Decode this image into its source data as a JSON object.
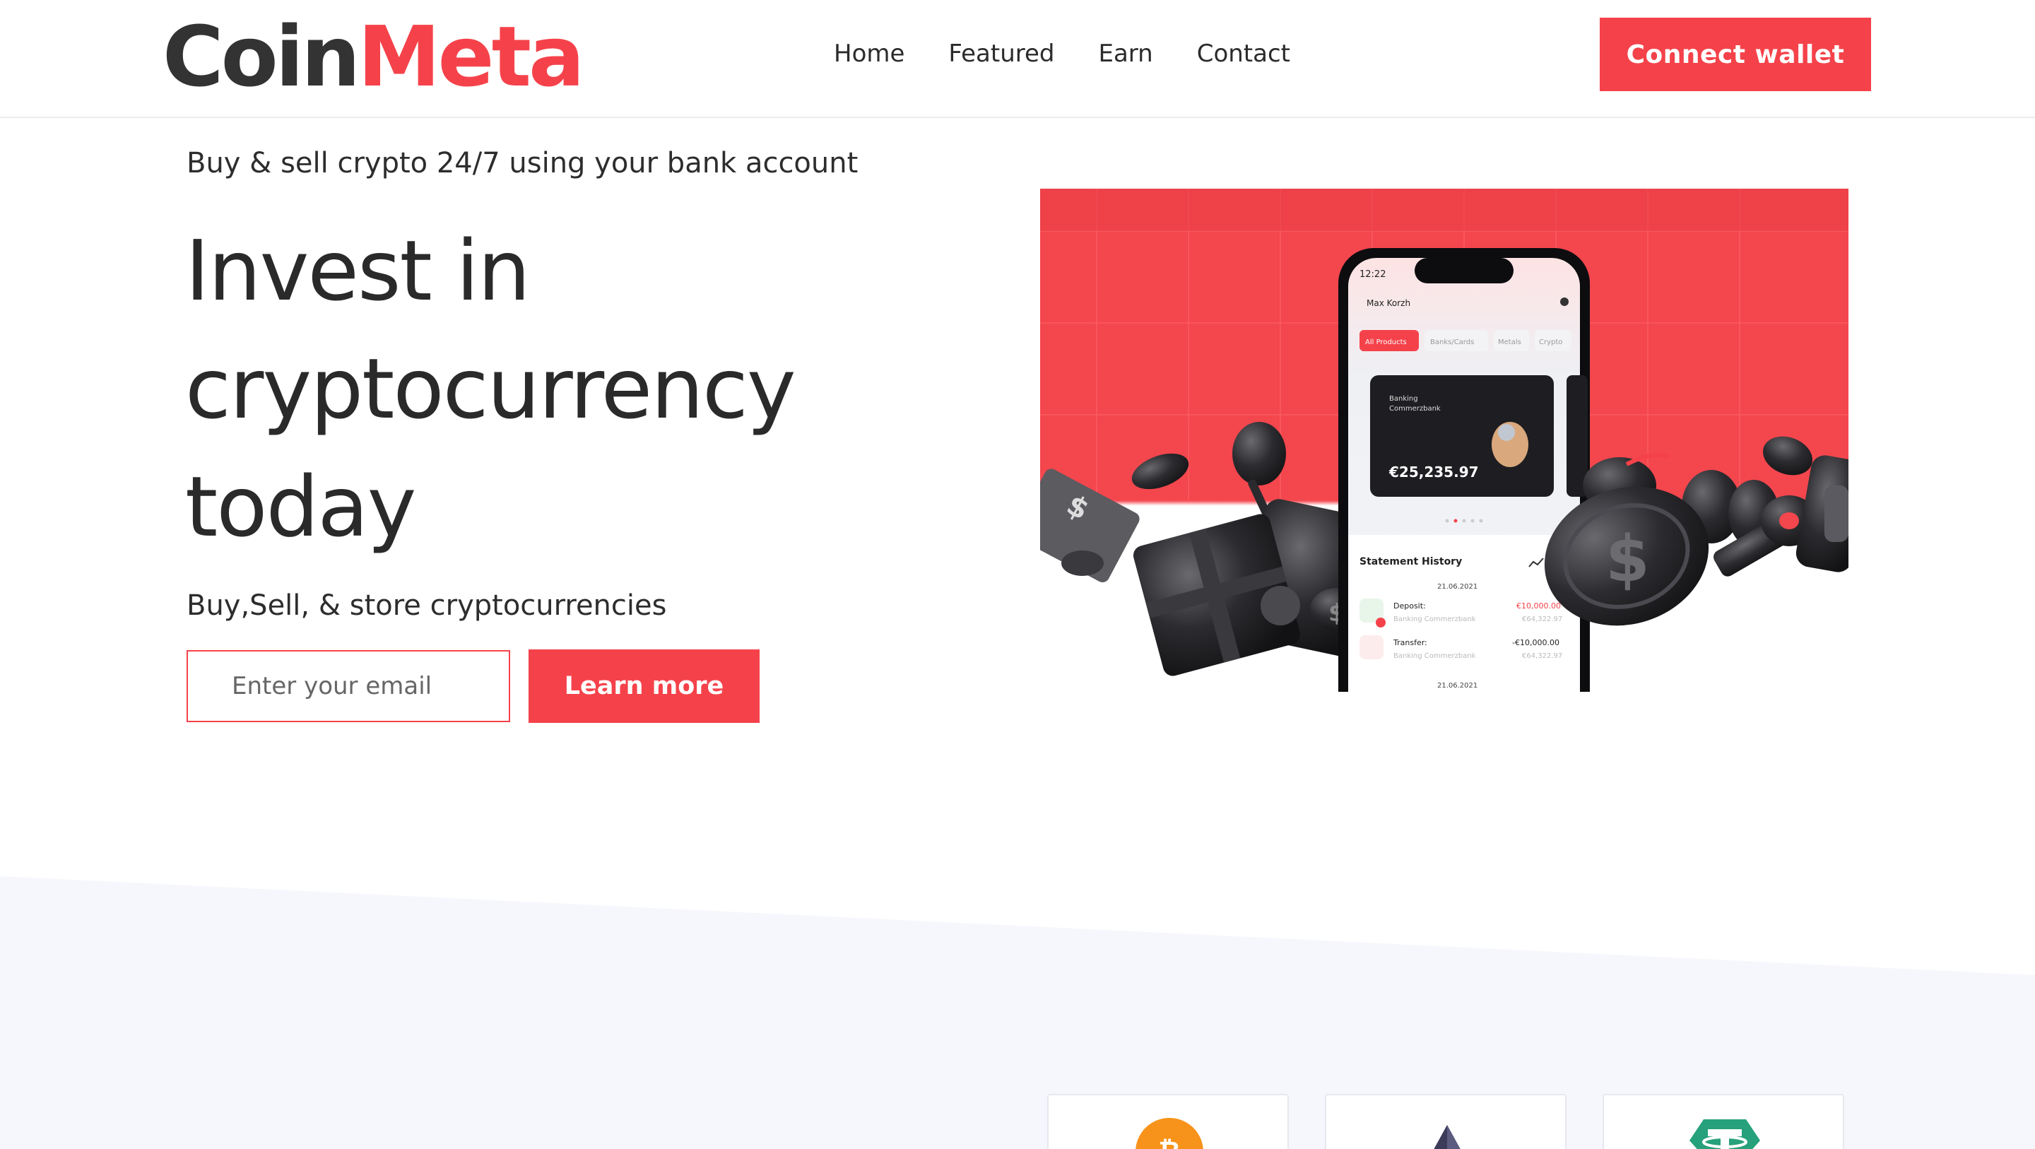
{
  "brand": {
    "name_part1": "Coin",
    "name_part2": "Meta",
    "dark_color": "#333333",
    "accent_color": "#f5424a"
  },
  "nav": {
    "items": [
      {
        "label": "Home"
      },
      {
        "label": "Featured"
      },
      {
        "label": "Earn"
      },
      {
        "label": "Contact"
      }
    ],
    "connect_label": "Connect wallet"
  },
  "hero": {
    "tagline": "Buy & sell crypto 24/7 using your bank account",
    "title_lines": [
      "Invest in",
      "cryptocurrency",
      "today"
    ],
    "subtitle": "Buy,Sell, & store cryptocurrencies",
    "email_placeholder": "Enter your email",
    "cta_label": "Learn more"
  },
  "phone": {
    "time": "12:22",
    "user": "Max Korzh",
    "tabs": [
      "All Products",
      "Banks/Cards",
      "Metals",
      "Crypto"
    ],
    "card_label_1": "Banking",
    "card_label_2": "Commerzbank",
    "card_balance": "€25,235.97",
    "history_title": "Statement History",
    "date_1": "21.06.2021",
    "tx": [
      {
        "label": "Deposit:",
        "sub": "Banking Commerzbank",
        "amount": "€10,000.00",
        "balance": "€64,322.97"
      },
      {
        "label": "Transfer:",
        "sub": "Banking Commerzbank",
        "amount": "-€10,000.00",
        "balance": "€64,322.97"
      }
    ],
    "date_2": "21.06.2021"
  },
  "coins": [
    {
      "icon": "bitcoin-icon",
      "color": "#f7931a"
    },
    {
      "icon": "ethereum-icon",
      "color": "#3c3c5a"
    },
    {
      "icon": "tether-icon",
      "color": "#26a17b"
    }
  ],
  "colors": {
    "lower_bg": "#f5f7fc"
  }
}
